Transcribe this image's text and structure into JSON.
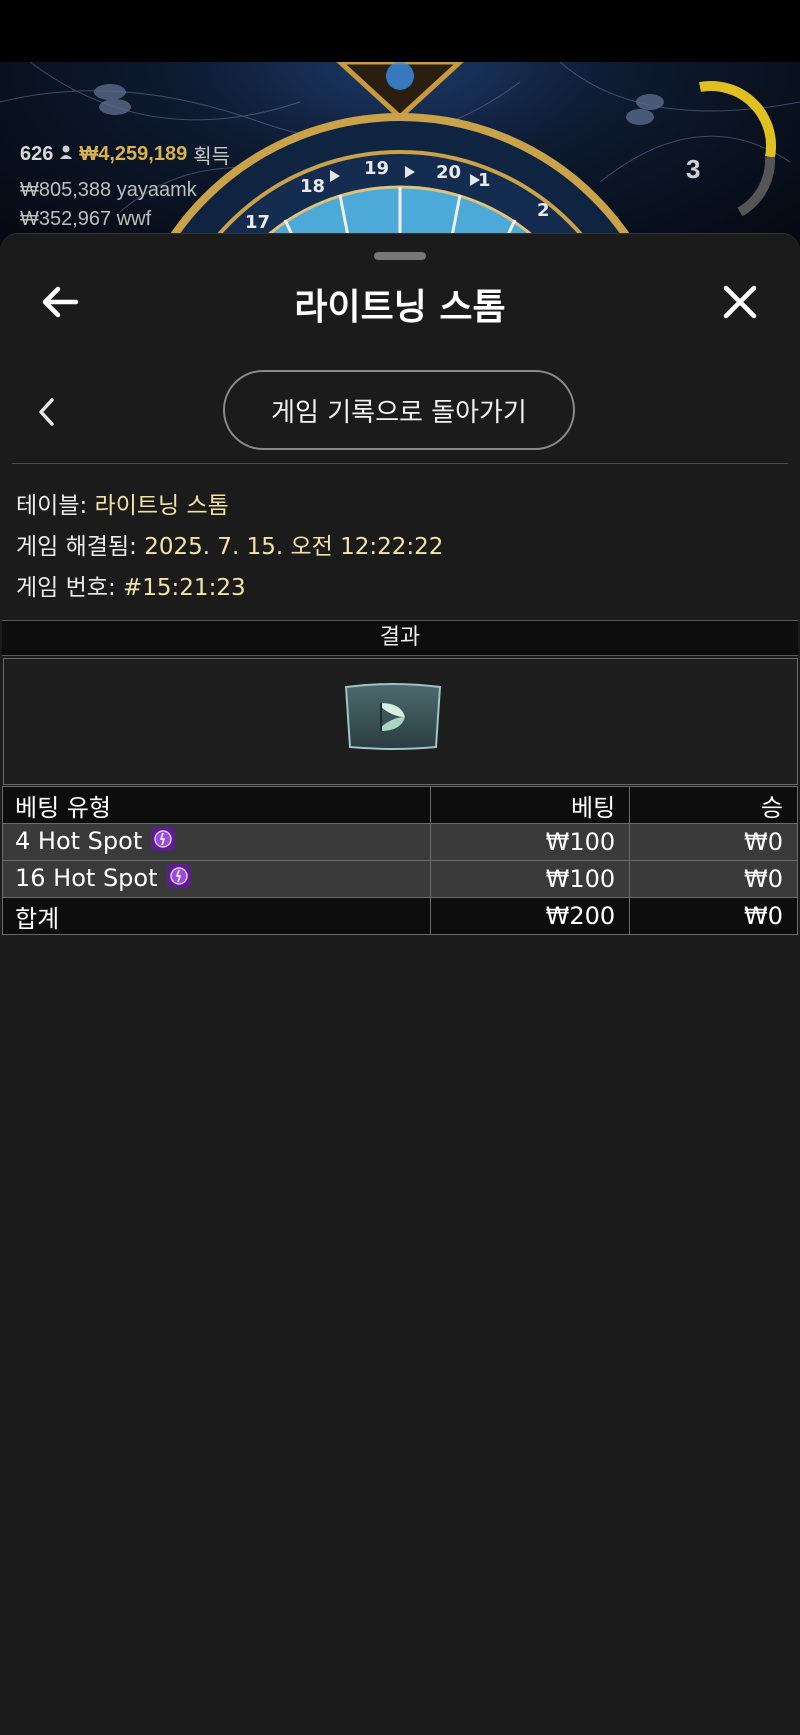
{
  "background": {
    "wheel_numbers": [
      "18",
      "19",
      "20",
      "1",
      "2",
      "17"
    ],
    "player_count": "626",
    "total_won": "₩4,259,189",
    "won_label": "획득",
    "winners": [
      {
        "amount": "₩805,388",
        "name": "yayaamk"
      },
      {
        "amount": "₩352,967",
        "name": "wwf"
      }
    ],
    "timer": "3"
  },
  "header": {
    "title": "라이트닝 스톰"
  },
  "nav": {
    "back_to_history": "게임 기록으로 돌아가기"
  },
  "info": {
    "table_label": "테이블:",
    "table_value": "라이트닝 스톰",
    "resolved_label": "게임 해결됨:",
    "resolved_value": "2025. 7. 15. 오전 12:22:22",
    "number_label": "게임 번호:",
    "number_value": "#15:21:23"
  },
  "result": {
    "label": "결과",
    "segment_icon": "leaf-segment-icon"
  },
  "bets_table": {
    "columns": [
      "베팅 유형",
      "베팅",
      "승"
    ],
    "rows": [
      {
        "type": "4 Hot Spot",
        "icon": "hot-spot-icon",
        "bet": "₩100",
        "win": "₩0"
      },
      {
        "type": "16 Hot Spot",
        "icon": "hot-spot-icon",
        "bet": "₩100",
        "win": "₩0"
      }
    ],
    "total": {
      "label": "합계",
      "bet": "₩200",
      "win": "₩0"
    }
  },
  "colors": {
    "sheet_bg": "#1b1b1b",
    "info_value": "#f3e3a6",
    "gold": "#d9b24c",
    "row_bg": "#3a3a3a",
    "header_row_bg": "#0d0d0d"
  }
}
